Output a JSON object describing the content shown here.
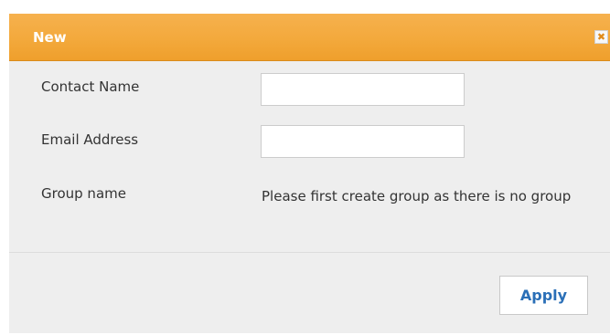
{
  "dialog": {
    "title": "New",
    "close_icon": "close-icon",
    "close_glyph": "✖"
  },
  "form": {
    "contact_name_label": "Contact Name",
    "contact_name_value": "",
    "email_label": "Email Address",
    "email_value": "",
    "group_label": "Group name",
    "group_message": "Please first create group as there is no group"
  },
  "footer": {
    "apply_label": "Apply"
  },
  "colors": {
    "titlebar": "#f3a93c",
    "dialog_bg": "#eeeeee",
    "apply_text": "#2a6fb7"
  }
}
